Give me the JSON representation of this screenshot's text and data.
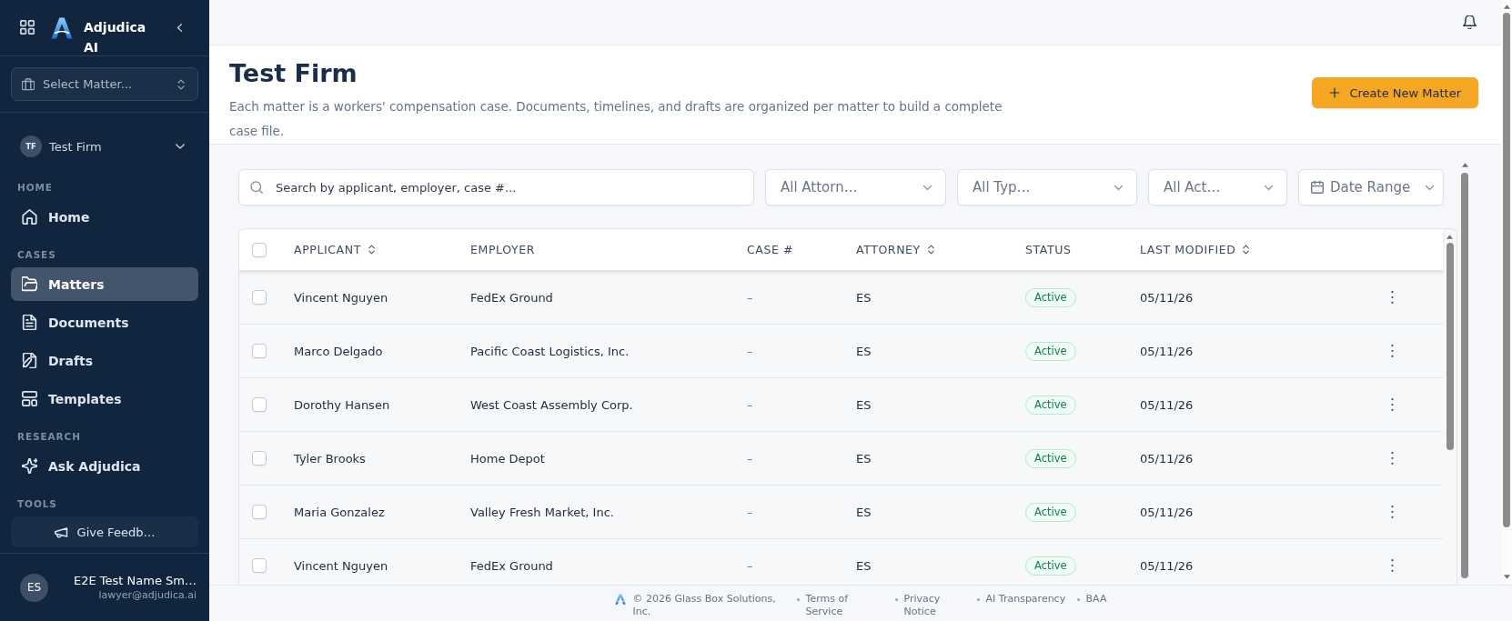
{
  "sidebar": {
    "brand": "Adjudica AI",
    "matter_select": {
      "placeholder": "Select Matter..."
    },
    "firm": {
      "initials": "TF",
      "name": "Test Firm"
    },
    "sections": [
      {
        "label": "HOME",
        "items": [
          {
            "kind": "link",
            "label": "Home",
            "selected": false
          }
        ]
      },
      {
        "label": "CASES",
        "items": [
          {
            "kind": "link",
            "label": "Matters",
            "selected": true
          },
          {
            "kind": "link",
            "label": "Documents",
            "selected": false
          },
          {
            "kind": "link",
            "label": "Drafts",
            "selected": false
          },
          {
            "kind": "link",
            "label": "Templates",
            "selected": false
          }
        ]
      },
      {
        "label": "RESEARCH",
        "items": [
          {
            "kind": "link",
            "label": "Ask Adjudica",
            "selected": false
          }
        ]
      },
      {
        "label": "TOOLS",
        "items": [
          {
            "kind": "button",
            "label": "Give Feedb…"
          }
        ]
      }
    ],
    "user": {
      "initials": "ES",
      "name": "E2E Test Name Sm…",
      "email": "lawyer@adjudica.ai"
    }
  },
  "page": {
    "title": "Test Firm",
    "description": "Each matter is a workers' compensation case. Documents, timelines, and drafts are organized per matter to build a complete case file.",
    "create_button": "Create New Matter"
  },
  "filters": {
    "search": {
      "placeholder": "Search by applicant, employer, case #..."
    },
    "dropdowns": [
      {
        "kind": "select",
        "value": "All Attorn…"
      },
      {
        "kind": "select",
        "value": "All Typ…"
      },
      {
        "kind": "select",
        "value": "All Act…"
      },
      {
        "kind": "date",
        "value": "Date Range"
      }
    ]
  },
  "table": {
    "select_all_checked": false,
    "columns": [
      {
        "label": "APPLICANT",
        "sortable": true
      },
      {
        "label": "EMPLOYER",
        "sortable": false
      },
      {
        "label": "CASE #",
        "sortable": false
      },
      {
        "label": "ATTORNEY",
        "sortable": true
      },
      {
        "label": "STATUS",
        "sortable": false
      },
      {
        "label": "LAST MODIFIED",
        "sortable": true
      }
    ],
    "rows": [
      {
        "checked": false,
        "applicant": "Vincent Nguyen",
        "employer": "FedEx Ground",
        "case_number": "–",
        "attorney": "ES",
        "status": "Active",
        "last_modified": "05/11/26"
      },
      {
        "checked": false,
        "applicant": "Marco Delgado",
        "employer": "Pacific Coast Logistics, Inc.",
        "case_number": "–",
        "attorney": "ES",
        "status": "Active",
        "last_modified": "05/11/26"
      },
      {
        "checked": false,
        "applicant": "Dorothy Hansen",
        "employer": "West Coast Assembly Corp.",
        "case_number": "–",
        "attorney": "ES",
        "status": "Active",
        "last_modified": "05/11/26"
      },
      {
        "checked": false,
        "applicant": "Tyler Brooks",
        "employer": "Home Depot",
        "case_number": "–",
        "attorney": "ES",
        "status": "Active",
        "last_modified": "05/11/26"
      },
      {
        "checked": false,
        "applicant": "Maria Gonzalez",
        "employer": "Valley Fresh Market, Inc.",
        "case_number": "–",
        "attorney": "ES",
        "status": "Active",
        "last_modified": "05/11/26"
      },
      {
        "checked": false,
        "applicant": "Vincent Nguyen",
        "employer": "FedEx Ground",
        "case_number": "–",
        "attorney": "ES",
        "status": "Active",
        "last_modified": "05/11/26"
      }
    ]
  },
  "footer": {
    "copyright": "© 2026 Glass Box Solutions, Inc.",
    "links": [
      "Terms of Service",
      "Privacy Notice",
      "AI Transparency",
      "BAA"
    ]
  }
}
